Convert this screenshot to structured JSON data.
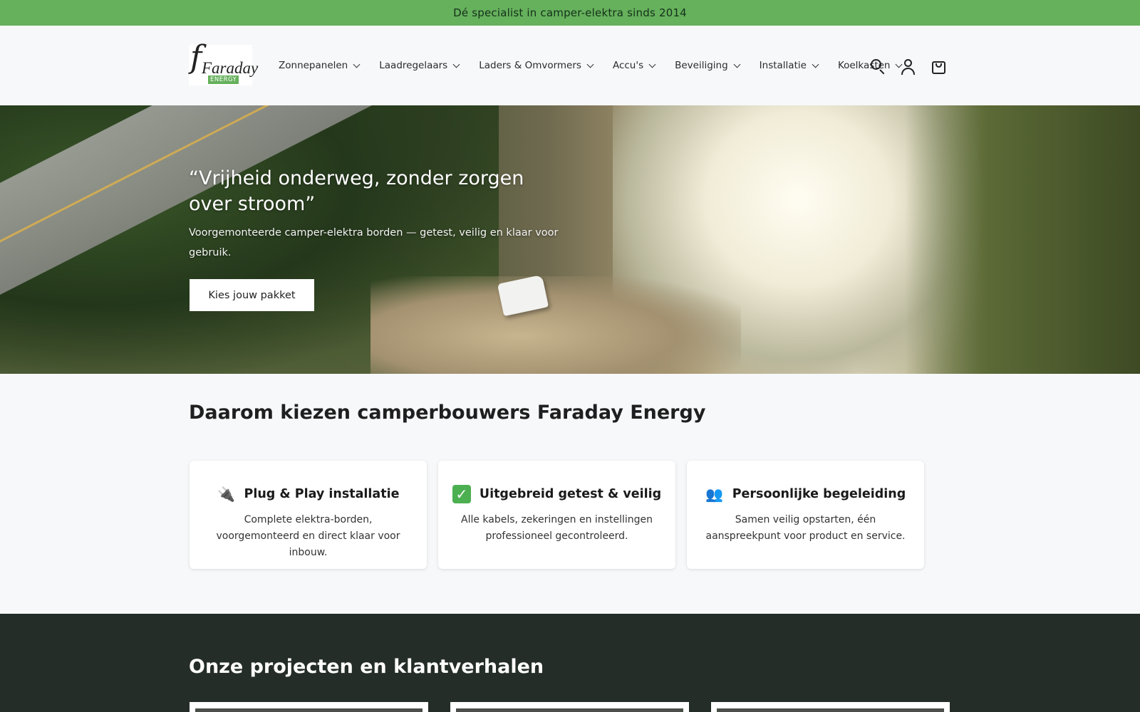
{
  "announcement": "Dé specialist in camper-elektra sinds 2014",
  "logo": {
    "name": "Faraday",
    "badge": "ENERGY"
  },
  "nav": [
    {
      "label": "Zonnepanelen"
    },
    {
      "label": "Laadregelaars"
    },
    {
      "label": "Laders & Omvormers"
    },
    {
      "label": "Accu's"
    },
    {
      "label": "Beveiliging"
    },
    {
      "label": "Installatie"
    },
    {
      "label": "Koelkasten"
    }
  ],
  "icons": {
    "search": "search-icon",
    "account": "account-icon",
    "cart": "cart-icon"
  },
  "hero": {
    "title": "“Vrijheid onderweg, zonder zorgen over stroom”",
    "subtitle": "Voorgemonteerde camper-elektra borden — getest, veilig en klaar voor gebruik.",
    "button": "Kies jouw pakket"
  },
  "why": {
    "title": "Daarom kiezen camperbouwers Faraday Energy",
    "cards": [
      {
        "icon": "plug-icon",
        "emoji": "🔌",
        "title": "Plug & Play installatie",
        "text": "Complete elektra-borden, voorgemonteerd en direct klaar voor inbouw."
      },
      {
        "icon": "check-icon",
        "emoji": "✓",
        "title": "Uitgebreid getest & veilig",
        "text": "Alle kabels, zekeringen en instellingen professioneel gecontroleerd."
      },
      {
        "icon": "people-icon",
        "emoji": "👥",
        "title": "Persoonlijke begeleiding",
        "text": "Samen veilig opstarten, één aanspreekpunt voor product en service."
      }
    ]
  },
  "projects": {
    "title": "Onze projecten en klantverhalen"
  },
  "colors": {
    "accent": "#66b15c",
    "dark": "#252d28"
  }
}
